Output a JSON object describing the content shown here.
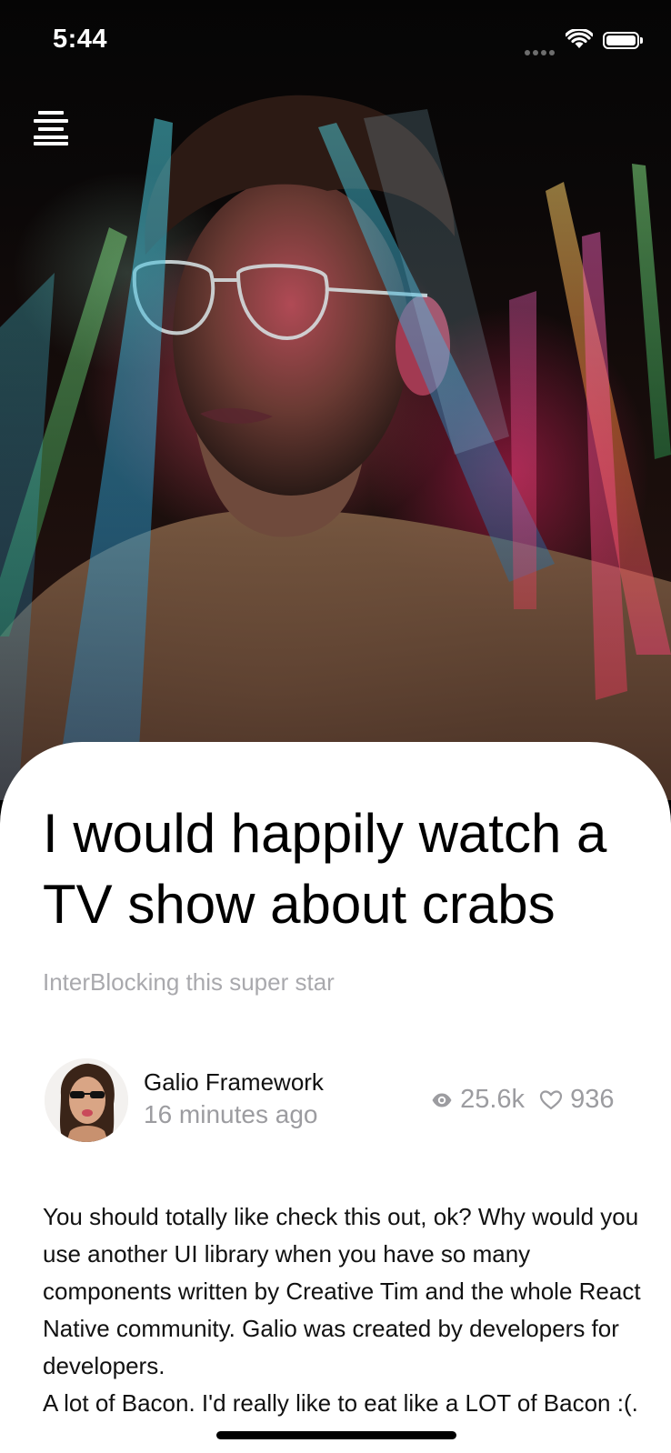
{
  "status_bar": {
    "time": "5:44"
  },
  "hero": {
    "image_icon": "portrait-photo"
  },
  "menu": {
    "icon": "menu-icon"
  },
  "article": {
    "title": "I would happily watch a TV show about crabs",
    "subtitle": "InterBlocking this super star",
    "author": {
      "name": "Galio Framework",
      "time": "16 minutes ago",
      "avatar_icon": "avatar"
    },
    "stats": {
      "views": "25.6k",
      "views_icon": "eye-icon",
      "likes": "936",
      "likes_icon": "heart-icon"
    },
    "body": [
      "You should totally like check this out, ok? Why would you use another UI library when you have so many components written by Creative Tim and the whole React Native community. Galio was created by developers for developers.",
      "A lot of Bacon. I'd really like to eat like a LOT of Bacon :(."
    ]
  },
  "colors": {
    "card_background": "#ffffff",
    "title_text": "#000000",
    "muted_text": "#9c9ca0",
    "status_text": "#ffffff"
  }
}
